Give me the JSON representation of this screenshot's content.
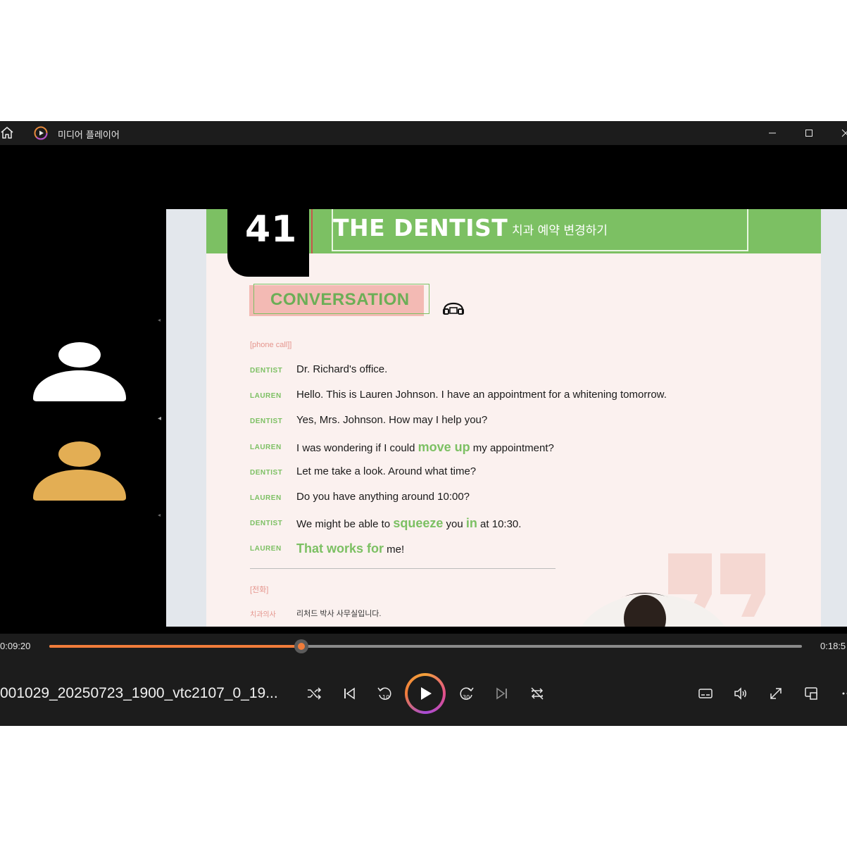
{
  "window": {
    "title": "미디어 플레이어",
    "buttons": {
      "minimize": "—",
      "maximize": "☐",
      "close": "✕"
    }
  },
  "participants": [
    {
      "name": "participant-1",
      "color": "#ffffff"
    },
    {
      "name": "participant-2",
      "color": "#e3ae54"
    }
  ],
  "slide": {
    "lesson_number": "41",
    "title": "THE DENTIST",
    "subtitle": "치과 예약 변경하기",
    "section_label": "CONVERSATION",
    "context": "[phone call]]",
    "lines": [
      {
        "speaker": "DENTIST",
        "parts": [
          {
            "t": "Dr. Richard's office.",
            "hl": false
          }
        ]
      },
      {
        "speaker": "LAUREN",
        "parts": [
          {
            "t": "Hello. This is Lauren Johnson. I have an appointment for a whitening tomorrow.",
            "hl": false
          }
        ]
      },
      {
        "speaker": "DENTIST",
        "parts": [
          {
            "t": "Yes, Mrs. Johnson. How may I help you?",
            "hl": false
          }
        ]
      },
      {
        "speaker": "LAUREN",
        "parts": [
          {
            "t": "I was wondering if I could ",
            "hl": false
          },
          {
            "t": "move up",
            "hl": true
          },
          {
            "t": " my appointment?",
            "hl": false
          }
        ]
      },
      {
        "speaker": "DENTIST",
        "parts": [
          {
            "t": "Let me take a look. Around what time?",
            "hl": false
          }
        ]
      },
      {
        "speaker": "LAUREN",
        "parts": [
          {
            "t": "Do you have anything around 10:00?",
            "hl": false
          }
        ]
      },
      {
        "speaker": "DENTIST",
        "parts": [
          {
            "t": "We might be able to ",
            "hl": false
          },
          {
            "t": "squeeze",
            "hl": true
          },
          {
            "t": " you ",
            "hl": false
          },
          {
            "t": "in",
            "hl": true
          },
          {
            "t": " at 10:30.",
            "hl": false
          }
        ]
      },
      {
        "speaker": "LAUREN",
        "parts": [
          {
            "t": "That works for",
            "hl": true
          },
          {
            "t": " me!",
            "hl": false
          }
        ]
      }
    ],
    "korean_label": "[전화]",
    "korean_lines": [
      {
        "speaker": "치과의사",
        "text": "리처드 박사 사무실입니다."
      }
    ]
  },
  "player": {
    "current_time": "0:09:20",
    "total_time": "0:18:5",
    "progress": 0.3345,
    "filename": "001029_20250723_1900_vtc2107_0_19...",
    "accent": "#f07c3a"
  }
}
